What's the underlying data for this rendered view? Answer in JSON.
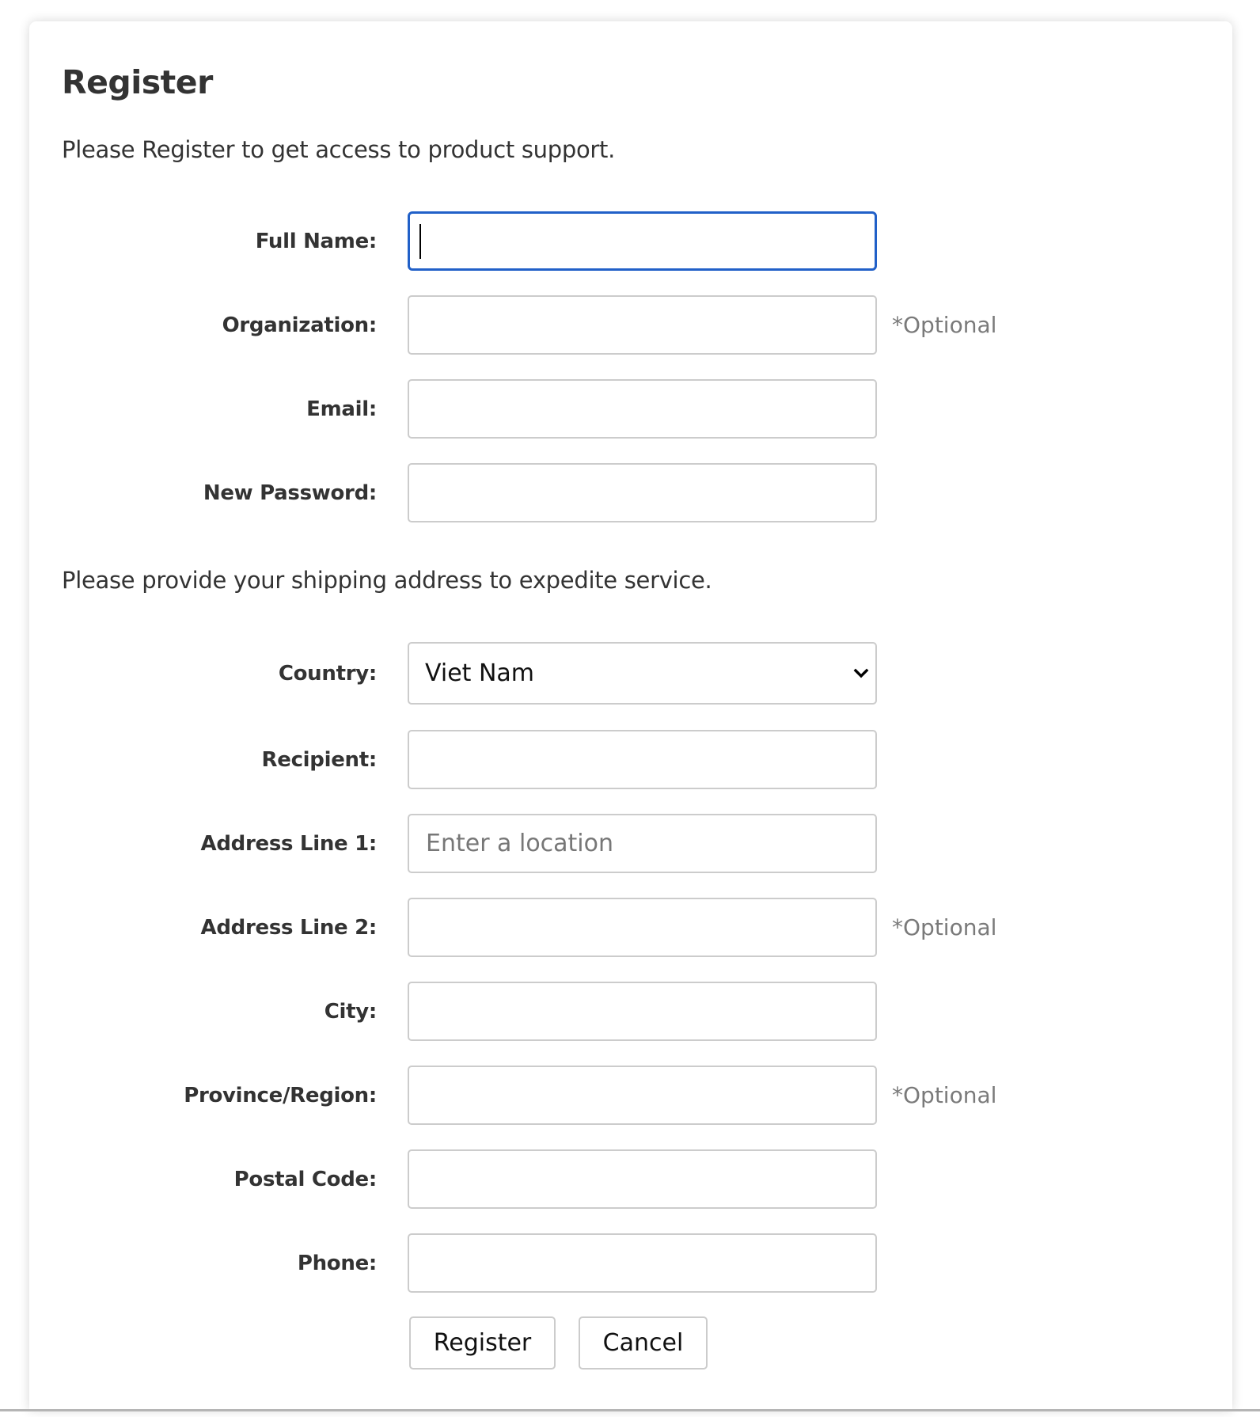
{
  "page": {
    "title": "Register",
    "intro": "Please Register to get access to product support.",
    "shipping_intro": "Please provide your shipping address to expedite service."
  },
  "account_fields": [
    {
      "label": "Full Name:",
      "value": "",
      "placeholder": "",
      "optional_note": "",
      "focused": true
    },
    {
      "label": "Organization:",
      "value": "",
      "placeholder": "",
      "optional_note": "*Optional"
    },
    {
      "label": "Email:",
      "value": "",
      "placeholder": "",
      "optional_note": ""
    },
    {
      "label": "New Password:",
      "value": "",
      "placeholder": "",
      "optional_note": ""
    }
  ],
  "country": {
    "label": "Country:",
    "selected": "Viet Nam",
    "icon": "chevron-down-icon"
  },
  "address_fields": [
    {
      "label": "Recipient:",
      "value": "",
      "placeholder": "",
      "optional_note": ""
    },
    {
      "label": "Address Line 1:",
      "value": "",
      "placeholder": "Enter a location",
      "optional_note": ""
    },
    {
      "label": "Address Line 2:",
      "value": "",
      "placeholder": "",
      "optional_note": "*Optional"
    },
    {
      "label": "City:",
      "value": "",
      "placeholder": "",
      "optional_note": ""
    },
    {
      "label": "Province/Region:",
      "value": "",
      "placeholder": "",
      "optional_note": "*Optional"
    },
    {
      "label": "Postal Code:",
      "value": "",
      "placeholder": "",
      "optional_note": ""
    },
    {
      "label": "Phone:",
      "value": "",
      "placeholder": "",
      "optional_note": ""
    }
  ],
  "buttons": {
    "register": "Register",
    "cancel": "Cancel"
  },
  "colors": {
    "focus_border": "#2160c8",
    "field_border": "#cccccc",
    "optional_text": "#7a7a7a",
    "text": "#333333"
  }
}
